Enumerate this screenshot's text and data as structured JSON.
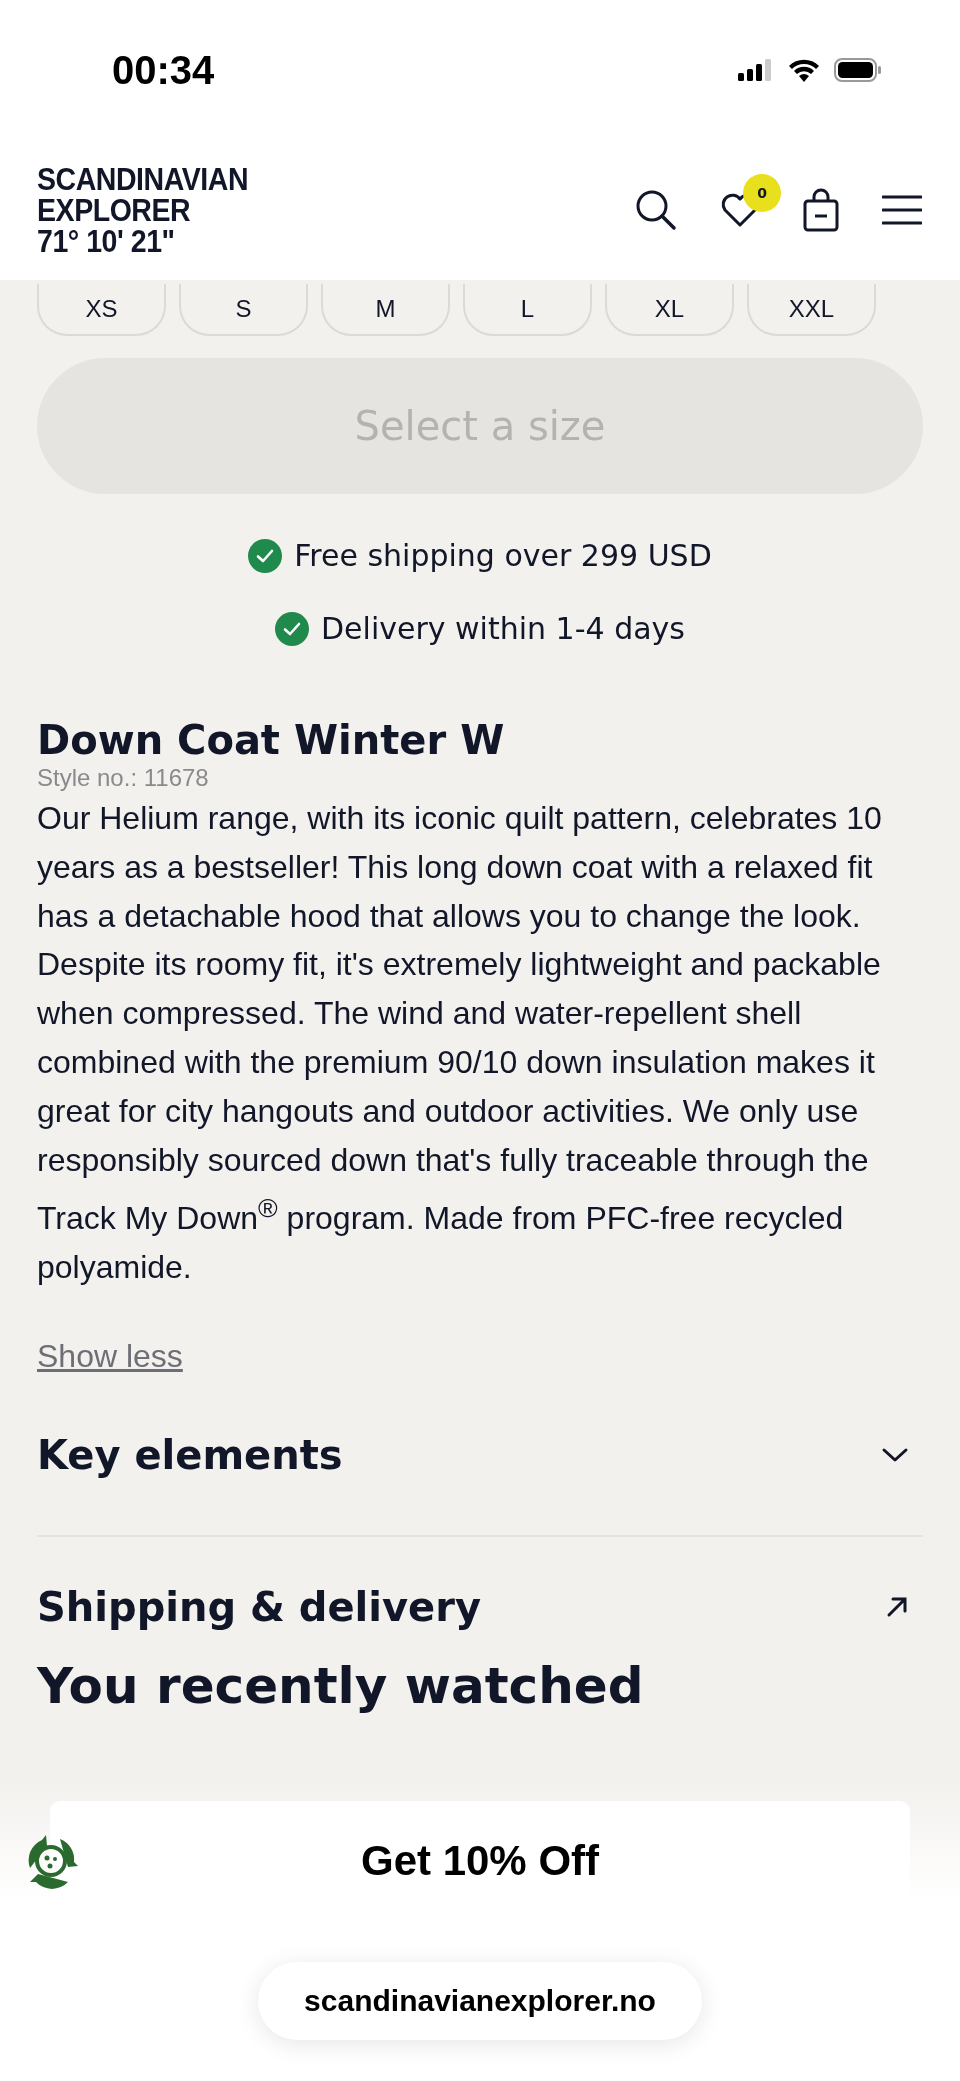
{
  "status_bar": {
    "time": "00:34"
  },
  "header": {
    "logo": [
      "SCANDINAVIAN",
      "EXPLORER",
      "71° 10' 21\""
    ],
    "wishlist_count": "0"
  },
  "sizes": [
    "XS",
    "S",
    "M",
    "L",
    "XL",
    "XXL"
  ],
  "add_button": {
    "label": "Select a size",
    "disabled": true
  },
  "perks": [
    "Free shipping over 299 USD",
    "Delivery within 1-4 days"
  ],
  "product": {
    "title": "Down Coat Winter W",
    "style_no": "Style no.: 11678",
    "description": "Our Helium range, with its iconic quilt pattern, celebrates 10 years as a bestseller! This long down coat with a relaxed fit has a detachable hood that allows you to change the look. Despite its roomy fit, it's extremely lightweight and packable when compressed. The wind and water-repellent shell combined with the premium 90/10 down insulation makes it great for city hangouts and outdoor activities. We only use responsibly sourced down that's fully traceable through the Track My Down$^{®}$ program. Made from PFC-free recycled polyamide.",
    "toggle": "Show less"
  },
  "sections": [
    {
      "label": "Key elements",
      "kind": "accordion",
      "expanded": false
    },
    {
      "label": "Shipping & delivery",
      "kind": "link"
    }
  ],
  "recently_watched": {
    "title": "You recently watched"
  },
  "promo": {
    "label": "Get 10% Off"
  },
  "browser": {
    "url": "scandinavianexplorer.no"
  }
}
